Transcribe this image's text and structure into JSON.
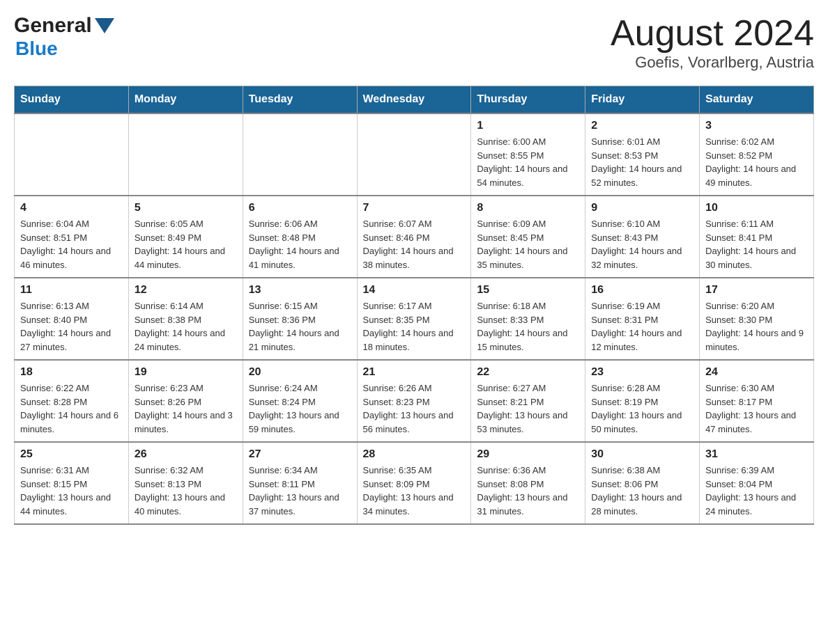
{
  "logo": {
    "general": "General",
    "triangle": "▶",
    "blue": "Blue"
  },
  "title": "August 2024",
  "subtitle": "Goefis, Vorarlberg, Austria",
  "days_of_week": [
    "Sunday",
    "Monday",
    "Tuesday",
    "Wednesday",
    "Thursday",
    "Friday",
    "Saturday"
  ],
  "weeks": [
    [
      {
        "day": "",
        "info": ""
      },
      {
        "day": "",
        "info": ""
      },
      {
        "day": "",
        "info": ""
      },
      {
        "day": "",
        "info": ""
      },
      {
        "day": "1",
        "info": "Sunrise: 6:00 AM\nSunset: 8:55 PM\nDaylight: 14 hours and 54 minutes."
      },
      {
        "day": "2",
        "info": "Sunrise: 6:01 AM\nSunset: 8:53 PM\nDaylight: 14 hours and 52 minutes."
      },
      {
        "day": "3",
        "info": "Sunrise: 6:02 AM\nSunset: 8:52 PM\nDaylight: 14 hours and 49 minutes."
      }
    ],
    [
      {
        "day": "4",
        "info": "Sunrise: 6:04 AM\nSunset: 8:51 PM\nDaylight: 14 hours and 46 minutes."
      },
      {
        "day": "5",
        "info": "Sunrise: 6:05 AM\nSunset: 8:49 PM\nDaylight: 14 hours and 44 minutes."
      },
      {
        "day": "6",
        "info": "Sunrise: 6:06 AM\nSunset: 8:48 PM\nDaylight: 14 hours and 41 minutes."
      },
      {
        "day": "7",
        "info": "Sunrise: 6:07 AM\nSunset: 8:46 PM\nDaylight: 14 hours and 38 minutes."
      },
      {
        "day": "8",
        "info": "Sunrise: 6:09 AM\nSunset: 8:45 PM\nDaylight: 14 hours and 35 minutes."
      },
      {
        "day": "9",
        "info": "Sunrise: 6:10 AM\nSunset: 8:43 PM\nDaylight: 14 hours and 32 minutes."
      },
      {
        "day": "10",
        "info": "Sunrise: 6:11 AM\nSunset: 8:41 PM\nDaylight: 14 hours and 30 minutes."
      }
    ],
    [
      {
        "day": "11",
        "info": "Sunrise: 6:13 AM\nSunset: 8:40 PM\nDaylight: 14 hours and 27 minutes."
      },
      {
        "day": "12",
        "info": "Sunrise: 6:14 AM\nSunset: 8:38 PM\nDaylight: 14 hours and 24 minutes."
      },
      {
        "day": "13",
        "info": "Sunrise: 6:15 AM\nSunset: 8:36 PM\nDaylight: 14 hours and 21 minutes."
      },
      {
        "day": "14",
        "info": "Sunrise: 6:17 AM\nSunset: 8:35 PM\nDaylight: 14 hours and 18 minutes."
      },
      {
        "day": "15",
        "info": "Sunrise: 6:18 AM\nSunset: 8:33 PM\nDaylight: 14 hours and 15 minutes."
      },
      {
        "day": "16",
        "info": "Sunrise: 6:19 AM\nSunset: 8:31 PM\nDaylight: 14 hours and 12 minutes."
      },
      {
        "day": "17",
        "info": "Sunrise: 6:20 AM\nSunset: 8:30 PM\nDaylight: 14 hours and 9 minutes."
      }
    ],
    [
      {
        "day": "18",
        "info": "Sunrise: 6:22 AM\nSunset: 8:28 PM\nDaylight: 14 hours and 6 minutes."
      },
      {
        "day": "19",
        "info": "Sunrise: 6:23 AM\nSunset: 8:26 PM\nDaylight: 14 hours and 3 minutes."
      },
      {
        "day": "20",
        "info": "Sunrise: 6:24 AM\nSunset: 8:24 PM\nDaylight: 13 hours and 59 minutes."
      },
      {
        "day": "21",
        "info": "Sunrise: 6:26 AM\nSunset: 8:23 PM\nDaylight: 13 hours and 56 minutes."
      },
      {
        "day": "22",
        "info": "Sunrise: 6:27 AM\nSunset: 8:21 PM\nDaylight: 13 hours and 53 minutes."
      },
      {
        "day": "23",
        "info": "Sunrise: 6:28 AM\nSunset: 8:19 PM\nDaylight: 13 hours and 50 minutes."
      },
      {
        "day": "24",
        "info": "Sunrise: 6:30 AM\nSunset: 8:17 PM\nDaylight: 13 hours and 47 minutes."
      }
    ],
    [
      {
        "day": "25",
        "info": "Sunrise: 6:31 AM\nSunset: 8:15 PM\nDaylight: 13 hours and 44 minutes."
      },
      {
        "day": "26",
        "info": "Sunrise: 6:32 AM\nSunset: 8:13 PM\nDaylight: 13 hours and 40 minutes."
      },
      {
        "day": "27",
        "info": "Sunrise: 6:34 AM\nSunset: 8:11 PM\nDaylight: 13 hours and 37 minutes."
      },
      {
        "day": "28",
        "info": "Sunrise: 6:35 AM\nSunset: 8:09 PM\nDaylight: 13 hours and 34 minutes."
      },
      {
        "day": "29",
        "info": "Sunrise: 6:36 AM\nSunset: 8:08 PM\nDaylight: 13 hours and 31 minutes."
      },
      {
        "day": "30",
        "info": "Sunrise: 6:38 AM\nSunset: 8:06 PM\nDaylight: 13 hours and 28 minutes."
      },
      {
        "day": "31",
        "info": "Sunrise: 6:39 AM\nSunset: 8:04 PM\nDaylight: 13 hours and 24 minutes."
      }
    ]
  ]
}
